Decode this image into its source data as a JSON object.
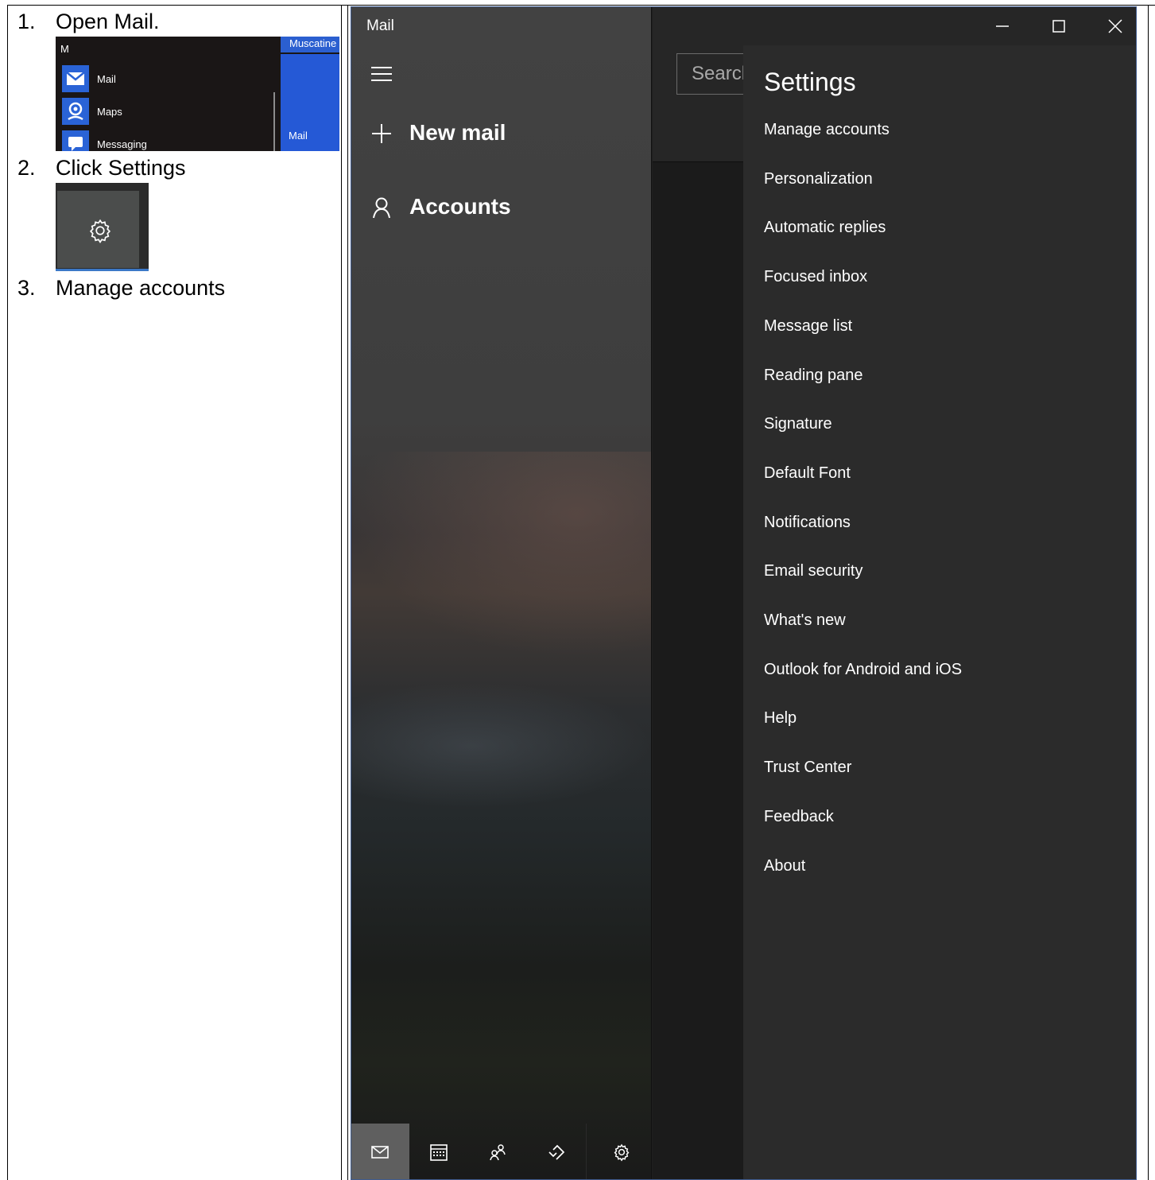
{
  "steps": [
    {
      "num": "1.",
      "text": "Open Mail."
    },
    {
      "num": "2.",
      "text": "Click Settings"
    },
    {
      "num": "3.",
      "text": "Manage accounts"
    }
  ],
  "start_menu": {
    "group_letter": "M",
    "apps": [
      {
        "label": "Mail",
        "icon": "mail-icon"
      },
      {
        "label": "Maps",
        "icon": "maps-icon"
      },
      {
        "label": "Messaging",
        "icon": "messaging-icon"
      }
    ],
    "live_tile_top": "Muscatine",
    "live_tile_label": "Mail"
  },
  "mail_app": {
    "title": "Mail",
    "nav": {
      "new_mail": "New mail",
      "accounts": "Accounts"
    },
    "search_placeholder": "Search",
    "settings_title": "Settings",
    "settings_items": [
      "Manage accounts",
      "Personalization",
      "Automatic replies",
      "Focused inbox",
      "Message list",
      "Reading pane",
      "Signature",
      "Default Font",
      "Notifications",
      "Email security",
      "What's new",
      "Outlook for Android and iOS",
      "Help",
      "Trust Center",
      "Feedback",
      "About"
    ],
    "bottom_icons": [
      "mail-icon",
      "calendar-icon",
      "people-icon",
      "todo-icon",
      "gear-icon"
    ],
    "colors": {
      "accent": "#2559d6",
      "settings_bg": "#2b2b2b",
      "nav_active": "#5f5f5f"
    }
  }
}
